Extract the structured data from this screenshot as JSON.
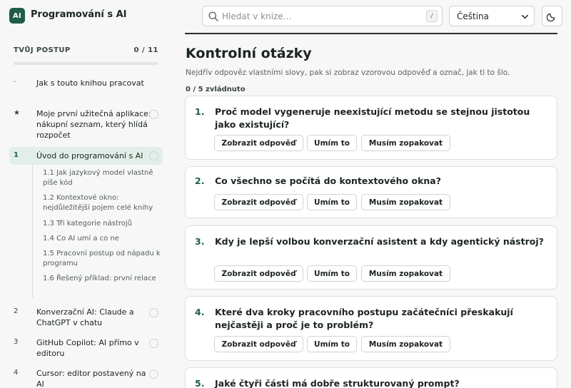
{
  "app": {
    "logo": "AI",
    "title": "Programování s AI"
  },
  "search": {
    "placeholder": "Hledat v knize…",
    "shortcut": "/"
  },
  "language": {
    "selected": "Čeština"
  },
  "icons": {
    "search": "search-icon",
    "theme": "moon-icon",
    "dropdown": "chevron-down-icon",
    "status": "circle-icon"
  },
  "colors": {
    "accent": "#1f5c4a",
    "active_bg": "#e2efe9"
  },
  "sidebar": {
    "progress_label": "TVŮJ POSTUP",
    "progress_count": "0 / 11",
    "progress_value": 0,
    "items": [
      {
        "num": "·",
        "label": "Jak s touto knihou pracovat",
        "has_status": false
      },
      {
        "num": "★",
        "label": "Moje první užitečná aplikace: nákupní seznam, který hlídá rozpočet",
        "has_status": true
      },
      {
        "num": "1",
        "label": "Úvod do programování s AI",
        "has_status": true,
        "active": true
      },
      {
        "num": "2",
        "label": "Konverzační AI: Claude a ChatGPT v chatu",
        "has_status": true
      },
      {
        "num": "3",
        "label": "GitHub Copilot: AI přímo v editoru",
        "has_status": true
      },
      {
        "num": "4",
        "label": "Cursor: editor postavený na AI",
        "has_status": true
      }
    ],
    "subitems": [
      "1.1  Jak jazykový model vlastně píše kód",
      "1.2  Kontextové okno: nejdůležitější pojem celé knihy",
      "1.3  Tři kategorie nástrojů",
      "1.4  Co AI umí a co ne",
      "1.5  Pracovní postup od nápadu k programu",
      "1.6  Řešený příklad: první relace"
    ]
  },
  "main": {
    "title": "Kontrolní otázky",
    "subtitle": "Nejdřív odpověz vlastními slovy, pak si zobraz vzorovou odpověď a označ, jak ti to šlo.",
    "count": "0 / 5 zvládnuto",
    "buttons": {
      "show": "Zobrazit odpověď",
      "know": "Umím to",
      "repeat": "Musím zopakovat"
    },
    "questions": [
      {
        "num": "1.",
        "text": "Proč model vygeneruje neexistující metodu se stejnou jistotou jako existující?"
      },
      {
        "num": "2.",
        "text": "Co všechno se počítá do kontextového okna?"
      },
      {
        "num": "3.",
        "text": "Kdy je lepší volbou konverzační asistent a kdy agentický nástroj?"
      },
      {
        "num": "4.",
        "text": "Které dva kroky pracovního postupu začátečníci přeskakují nejčastěji a proč je to problém?"
      },
      {
        "num": "5.",
        "text": "Jaké čtyři části má dobře strukturovaný prompt?"
      }
    ]
  }
}
